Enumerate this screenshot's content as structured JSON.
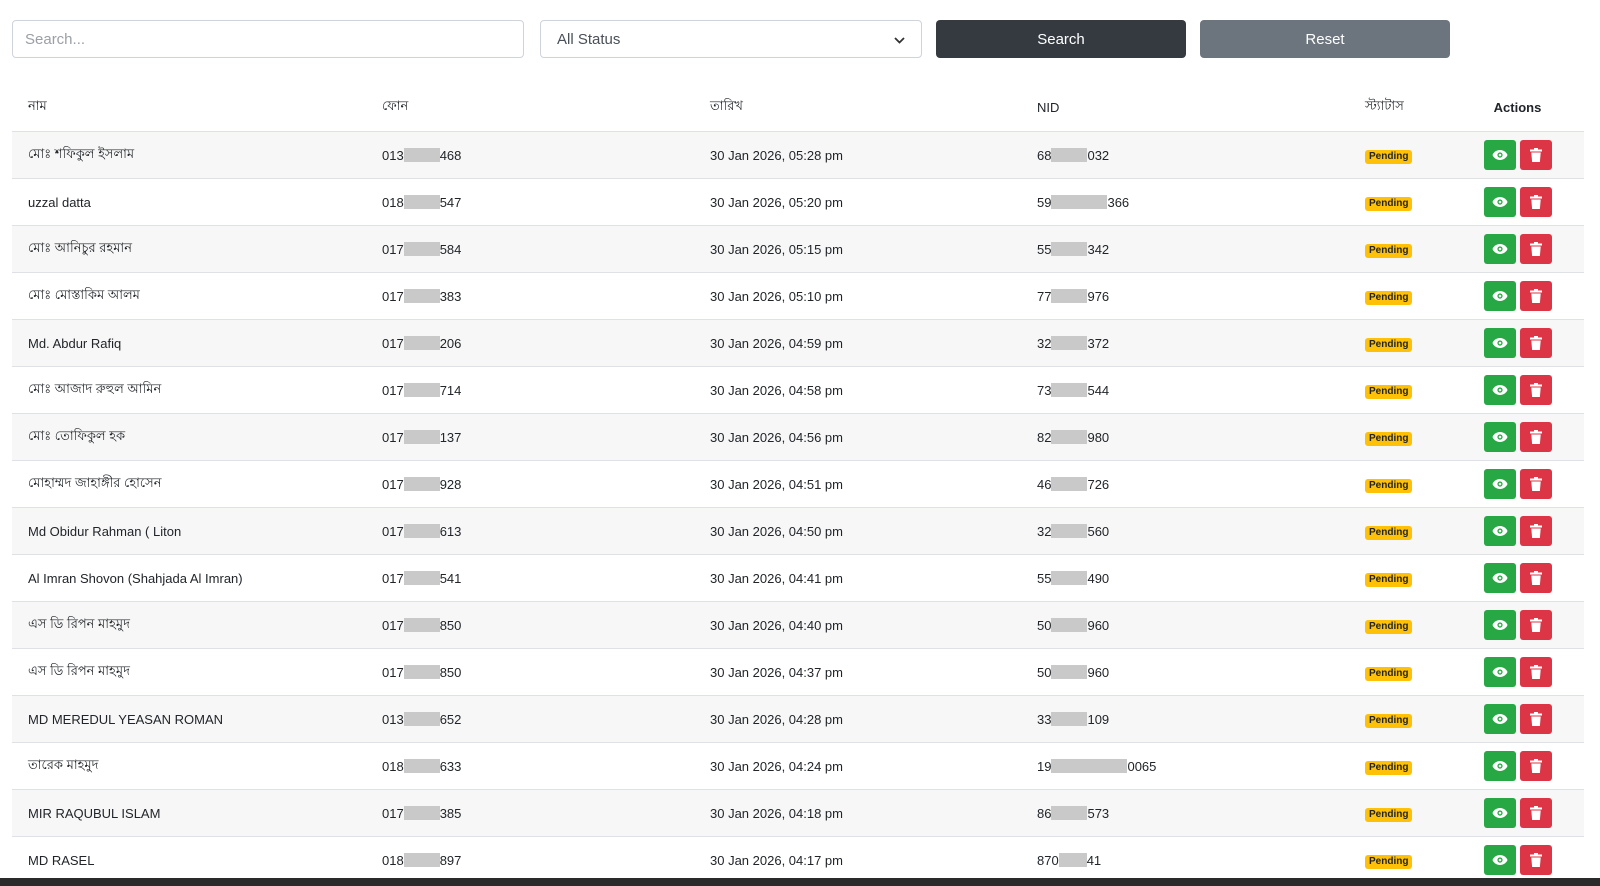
{
  "filters": {
    "search_placeholder": "Search...",
    "status_selected": "All Status",
    "search_label": "Search",
    "reset_label": "Reset"
  },
  "table": {
    "headers": {
      "name": "নাম",
      "phone": "ফোন",
      "date": "তারিখ",
      "nid": "NID",
      "status": "স্ট্যাটাস",
      "actions": "Actions"
    },
    "rows": [
      {
        "name": "মোঃ শফিকুল ইসলাম",
        "phone_prefix": "013",
        "phone_suffix": "468",
        "date": "30 Jan 2026, 05:28 pm",
        "nid_prefix": "68",
        "nid_suffix": "032",
        "status": "Pending"
      },
      {
        "name": "uzzal datta",
        "phone_prefix": "018",
        "phone_suffix": "547",
        "date": "30 Jan 2026, 05:20 pm",
        "nid_prefix": "59",
        "nid_suffix": "366",
        "status": "Pending"
      },
      {
        "name": "মোঃ আনিচুর রহমান",
        "phone_prefix": "017",
        "phone_suffix": "584",
        "date": "30 Jan 2026, 05:15 pm",
        "nid_prefix": "55",
        "nid_suffix": "342",
        "status": "Pending"
      },
      {
        "name": "মোঃ মোস্তাকিম আলম",
        "phone_prefix": "017",
        "phone_suffix": "383",
        "date": "30 Jan 2026, 05:10 pm",
        "nid_prefix": "77",
        "nid_suffix": "976",
        "status": "Pending"
      },
      {
        "name": "Md. Abdur Rafiq",
        "phone_prefix": "017",
        "phone_suffix": "206",
        "date": "30 Jan 2026, 04:59 pm",
        "nid_prefix": "32",
        "nid_suffix": "372",
        "status": "Pending"
      },
      {
        "name": "মোঃ আজাদ রুহুল আমিন",
        "phone_prefix": "017",
        "phone_suffix": "714",
        "date": "30 Jan 2026, 04:58 pm",
        "nid_prefix": "73",
        "nid_suffix": "544",
        "status": "Pending"
      },
      {
        "name": "মোঃ তোফিকুল হক",
        "phone_prefix": "017",
        "phone_suffix": "137",
        "date": "30 Jan 2026, 04:56 pm",
        "nid_prefix": "82",
        "nid_suffix": "980",
        "status": "Pending"
      },
      {
        "name": "মোহাম্মদ জাহাঙ্গীর হোসেন",
        "phone_prefix": "017",
        "phone_suffix": "928",
        "date": "30 Jan 2026, 04:51 pm",
        "nid_prefix": "46",
        "nid_suffix": "726",
        "status": "Pending"
      },
      {
        "name": "Md Obidur Rahman ( Liton",
        "phone_prefix": "017",
        "phone_suffix": "613",
        "date": "30 Jan 2026, 04:50 pm",
        "nid_prefix": "32",
        "nid_suffix": "560",
        "status": "Pending"
      },
      {
        "name": "Al Imran Shovon (Shahjada Al Imran)",
        "phone_prefix": "017",
        "phone_suffix": "541",
        "date": "30 Jan 2026, 04:41 pm",
        "nid_prefix": "55",
        "nid_suffix": "490",
        "status": "Pending"
      },
      {
        "name": "এস ডি রিপন মাহমুদ",
        "phone_prefix": "017",
        "phone_suffix": "850",
        "date": "30 Jan 2026, 04:40 pm",
        "nid_prefix": "50",
        "nid_suffix": "960",
        "status": "Pending"
      },
      {
        "name": "এস ডি রিপন মাহমুদ",
        "phone_prefix": "017",
        "phone_suffix": "850",
        "date": "30 Jan 2026, 04:37 pm",
        "nid_prefix": "50",
        "nid_suffix": "960",
        "status": "Pending"
      },
      {
        "name": "MD MEREDUL YEASAN ROMAN",
        "phone_prefix": "013",
        "phone_suffix": "652",
        "date": "30 Jan 2026, 04:28 pm",
        "nid_prefix": "33",
        "nid_suffix": "109",
        "status": "Pending"
      },
      {
        "name": "তারেক মাহমুদ",
        "phone_prefix": "018",
        "phone_suffix": "633",
        "date": "30 Jan 2026, 04:24 pm",
        "nid_prefix": "19",
        "nid_suffix": "0065",
        "status": "Pending"
      },
      {
        "name": "MIR RAQUBUL ISLAM",
        "phone_prefix": "017",
        "phone_suffix": "385",
        "date": "30 Jan 2026, 04:18 pm",
        "nid_prefix": "86",
        "nid_suffix": "573",
        "status": "Pending"
      },
      {
        "name": "MD RASEL",
        "phone_prefix": "018",
        "phone_suffix": "897",
        "date": "30 Jan 2026, 04:17 pm",
        "nid_prefix": "870",
        "nid_suffix": "41",
        "status": "Pending"
      }
    ]
  },
  "icons": {
    "view": "eye-icon",
    "delete": "trash-icon",
    "select": "chevron-down-icon"
  },
  "colors": {
    "search_btn": "#343a40",
    "reset_btn": "#6c757d",
    "view_btn": "#28a745",
    "delete_btn": "#dc3545",
    "pending_badge": "#ffc107"
  }
}
